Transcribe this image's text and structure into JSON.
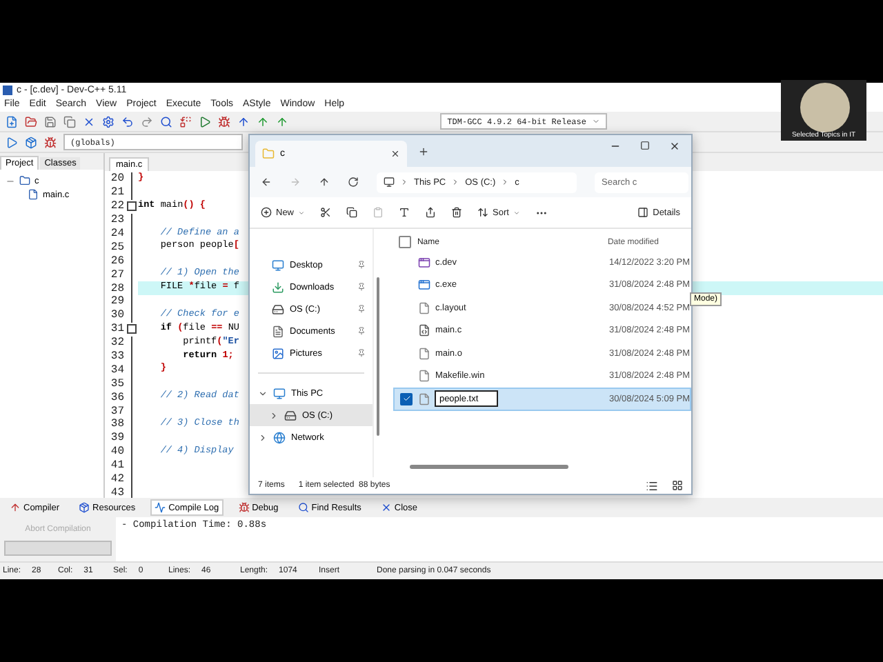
{
  "ide": {
    "title": "c - [c.dev] - Dev-C++ 5.11",
    "menu": [
      "File",
      "Edit",
      "Search",
      "View",
      "Project",
      "Execute",
      "Tools",
      "AStyle",
      "Window",
      "Help"
    ],
    "scope": "(globals)",
    "compiler": "TDM-GCC 4.9.2 64-bit Release",
    "panel_tabs": [
      {
        "label": "Project",
        "selected": true
      },
      {
        "label": "Classes",
        "selected": false
      }
    ],
    "project": {
      "name": "c",
      "expanded": true,
      "children": [
        {
          "name": "main.c"
        }
      ]
    },
    "editor_tab": "main.c",
    "code": [
      {
        "number": "20",
        "foldable": false,
        "highlighted": false,
        "segments": [
          {
            "kind": "sym",
            "text": "}"
          }
        ]
      },
      {
        "number": "21",
        "foldable": false,
        "highlighted": false
      },
      {
        "number": "22",
        "foldable": true,
        "highlighted": false,
        "segments": [
          {
            "kind": "kw",
            "text": "int"
          },
          {
            "kind": "id",
            "text": " main"
          },
          {
            "kind": "sym",
            "text": "() {"
          }
        ]
      },
      {
        "number": "23",
        "foldable": false,
        "highlighted": false
      },
      {
        "number": "24",
        "foldable": false,
        "highlighted": false,
        "segments": [
          {
            "kind": "com",
            "text": "    // Define an a"
          }
        ]
      },
      {
        "number": "25",
        "foldable": false,
        "highlighted": false,
        "segments": [
          {
            "kind": "id",
            "text": "    person people"
          },
          {
            "kind": "sym",
            "text": "["
          }
        ]
      },
      {
        "number": "26",
        "foldable": false,
        "highlighted": false
      },
      {
        "number": "27",
        "foldable": false,
        "highlighted": false,
        "segments": [
          {
            "kind": "com",
            "text": "    // 1) Open the"
          }
        ]
      },
      {
        "number": "28",
        "foldable": false,
        "highlighted": true,
        "segments": [
          {
            "kind": "id",
            "text": "    FILE "
          },
          {
            "kind": "sym",
            "text": "*"
          },
          {
            "kind": "id",
            "text": "file "
          },
          {
            "kind": "sym",
            "text": "= "
          },
          {
            "kind": "id",
            "text": "f"
          }
        ]
      },
      {
        "number": "29",
        "foldable": false,
        "highlighted": false
      },
      {
        "number": "30",
        "foldable": false,
        "highlighted": false,
        "segments": [
          {
            "kind": "com",
            "text": "    // Check for e"
          }
        ]
      },
      {
        "number": "31",
        "foldable": true,
        "highlighted": false,
        "segments": [
          {
            "kind": "kw",
            "text": "    if "
          },
          {
            "kind": "sym",
            "text": "("
          },
          {
            "kind": "id",
            "text": "file "
          },
          {
            "kind": "sym",
            "text": "== "
          },
          {
            "kind": "id",
            "text": "NU"
          }
        ]
      },
      {
        "number": "32",
        "foldable": false,
        "highlighted": false,
        "segments": [
          {
            "kind": "id",
            "text": "        printf"
          },
          {
            "kind": "sym",
            "text": "("
          },
          {
            "kind": "str",
            "text": "\"Er"
          }
        ]
      },
      {
        "number": "33",
        "foldable": false,
        "highlighted": false,
        "segments": [
          {
            "kind": "kw",
            "text": "        return "
          },
          {
            "kind": "sym",
            "text": "1;"
          }
        ]
      },
      {
        "number": "34",
        "foldable": false,
        "highlighted": false,
        "segments": [
          {
            "kind": "sym",
            "text": "    }"
          }
        ]
      },
      {
        "number": "35",
        "foldable": false,
        "highlighted": false
      },
      {
        "number": "36",
        "foldable": false,
        "highlighted": false,
        "segments": [
          {
            "kind": "com",
            "text": "    // 2) Read dat"
          }
        ]
      },
      {
        "number": "37",
        "foldable": false,
        "highlighted": false
      },
      {
        "number": "38",
        "foldable": false,
        "highlighted": false,
        "segments": [
          {
            "kind": "com",
            "text": "    // 3) Close th"
          }
        ]
      },
      {
        "number": "39",
        "foldable": false,
        "highlighted": false
      },
      {
        "number": "40",
        "foldable": false,
        "highlighted": false,
        "segments": [
          {
            "kind": "com",
            "text": "    // 4) Display"
          }
        ]
      },
      {
        "number": "41",
        "foldable": false,
        "highlighted": false
      },
      {
        "number": "42",
        "foldable": false,
        "highlighted": false
      },
      {
        "number": "43",
        "foldable": false,
        "highlighted": false
      }
    ],
    "tooltip": "Mode)",
    "bottom_tabs": [
      {
        "label": "Compiler",
        "selected": false
      },
      {
        "label": "Resources",
        "selected": false
      },
      {
        "label": "Compile Log",
        "selected": true
      },
      {
        "label": "Debug",
        "selected": false
      },
      {
        "label": "Find Results",
        "selected": false
      },
      {
        "label": "Close",
        "selected": false
      }
    ],
    "abort_button": {
      "label": "Abort Compilation",
      "disabled": true
    },
    "log": "- Compilation Time: 0.88s",
    "status_bar": [
      {
        "label": "Line:",
        "value": "28"
      },
      {
        "label": "Col:",
        "value": "31"
      },
      {
        "label": "Sel:",
        "value": "0"
      },
      {
        "label": "Lines:",
        "value": "46"
      },
      {
        "label": "Length:",
        "value": "1074"
      },
      {
        "value": "Insert"
      },
      {
        "value": "Done parsing in 0.047 seconds"
      }
    ]
  },
  "explorer": {
    "tab_title": "c",
    "breadcrumb": [
      "This PC",
      "OS (C:)",
      "c"
    ],
    "search": {
      "placeholder": "Search c"
    },
    "commands": {
      "new": "New",
      "sort": "Sort",
      "details": "Details"
    },
    "select_all": {
      "checked": false
    },
    "columns": [
      "Name",
      "Date modified"
    ],
    "quick_access": [
      {
        "name": "Desktop",
        "kind": "desktop"
      },
      {
        "name": "Downloads",
        "kind": "download"
      },
      {
        "name": "OS (C:)",
        "kind": "drive"
      },
      {
        "name": "Documents",
        "kind": "document"
      },
      {
        "name": "Pictures",
        "kind": "picture"
      }
    ],
    "tree": [
      {
        "name": "This PC",
        "kind": "pc",
        "expanded": true,
        "selected": false,
        "children": [
          {
            "name": "OS (C:)",
            "kind": "drive",
            "expanded": false,
            "selected": true
          }
        ]
      },
      {
        "name": "Network",
        "kind": "network",
        "expanded": false,
        "selected": false
      }
    ],
    "files": [
      {
        "name": "c.dev",
        "date": "14/12/2022 3:20 PM",
        "kind": "project",
        "selected": false
      },
      {
        "name": "c.exe",
        "date": "31/08/2024 2:48 PM",
        "kind": "exe",
        "selected": false
      },
      {
        "name": "c.layout",
        "date": "30/08/2024 4:52 PM",
        "kind": "file",
        "selected": false
      },
      {
        "name": "main.c",
        "date": "31/08/2024 2:48 PM",
        "kind": "source",
        "selected": false
      },
      {
        "name": "main.o",
        "date": "31/08/2024 2:48 PM",
        "kind": "file",
        "selected": false
      },
      {
        "name": "Makefile.win",
        "date": "31/08/2024 2:48 PM",
        "kind": "file",
        "selected": false
      },
      {
        "name": "people.txt",
        "date": "30/08/2024 5:09 PM",
        "kind": "file",
        "selected": true
      }
    ],
    "status": {
      "count": "7 items",
      "selection": "1 item selected  88 bytes"
    }
  },
  "webcam": {
    "caption": "Selected Topics in IT"
  }
}
